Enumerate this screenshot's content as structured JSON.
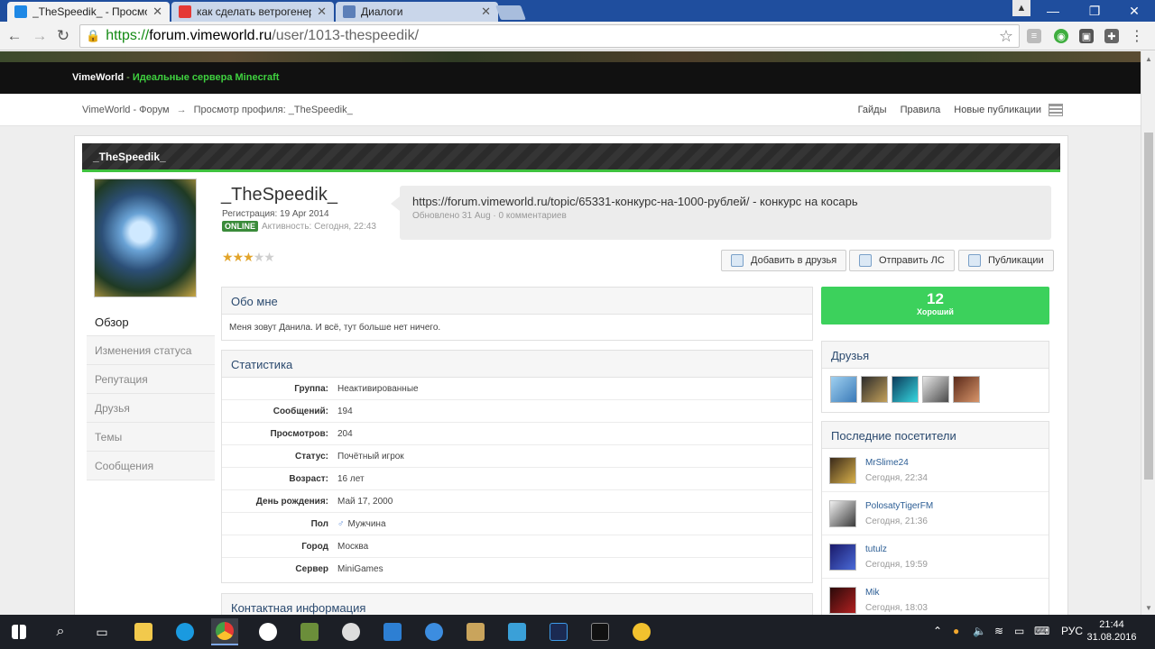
{
  "browser": {
    "tabs": [
      {
        "title": "_TheSpeedik_ - Просмотр",
        "favicon": "vimeworld-icon",
        "color": "#1e88e5"
      },
      {
        "title": "как сделать ветрогенерато",
        "favicon": "youtube-icon",
        "color": "#e53935"
      },
      {
        "title": "Диалоги",
        "favicon": "chat-icon",
        "color": "#5c7fb8"
      }
    ],
    "url": {
      "scheme": "https://",
      "host": "forum.vimeworld.ru",
      "path": "/user/1013-thespeedik/"
    }
  },
  "site": {
    "brand": "VimeWorld",
    "separator": " - ",
    "tagline": "Идеальные сервера Minecraft",
    "breadcrumb": {
      "home": "VimeWorld - Форум",
      "arrow": "→",
      "current": "Просмотр профиля: _TheSpeedik_"
    },
    "toplinks": [
      "Гайды",
      "Правила",
      "Новые публикации"
    ]
  },
  "profile": {
    "header_name": "_TheSpeedik_",
    "username": "_TheSpeedik_",
    "registration": "Регистрация: 19 Apr 2014",
    "online_badge": "ONLINE",
    "activity": "Активность: Сегодня, 22:43",
    "rating_stars": 3,
    "rating_max": 5,
    "status_text": "https://forum.vimeworld.ru/topic/65331-конкурс-на-1000-рублей/ - конкурс на косарь",
    "status_meta": "Обновлено 31 Aug · 0 комментариев",
    "buttons": {
      "add_friend": "Добавить в друзья",
      "send_pm": "Отправить ЛС",
      "posts": "Публикации"
    },
    "menu": [
      "Обзор",
      "Изменения статуса",
      "Репутация",
      "Друзья",
      "Темы",
      "Сообщения"
    ],
    "about": {
      "title": "Обо мне",
      "text": "Меня зовут Данила. И всё, тут больше нет ничего."
    },
    "stats": {
      "title": "Статистика",
      "rows": [
        {
          "k": "Группа:",
          "v": "Неактивированные"
        },
        {
          "k": "Сообщений:",
          "v": "194"
        },
        {
          "k": "Просмотров:",
          "v": "204"
        },
        {
          "k": "Статус:",
          "v": "Почётный игрок"
        },
        {
          "k": "Возраст:",
          "v": "16 лет"
        },
        {
          "k": "День рождения:",
          "v": "Май 17, 2000"
        },
        {
          "k": "Пол",
          "v": "Мужчина"
        },
        {
          "k": "Город",
          "v": "Москва"
        },
        {
          "k": "Сервер",
          "v": "MiniGames"
        }
      ]
    },
    "contact_title": "Контактная информация",
    "reputation": {
      "value": "12",
      "label": "Хороший"
    },
    "friends_title": "Друзья",
    "visitors": {
      "title": "Последние посетители",
      "items": [
        {
          "name": "MrSlime24",
          "time": "Сегодня, 22:34"
        },
        {
          "name": "PolosatyTigerFM",
          "time": "Сегодня, 21:36"
        },
        {
          "name": "tutulz",
          "time": "Сегодня, 19:59"
        },
        {
          "name": "Mik",
          "time": "Сегодня, 18:03"
        }
      ]
    }
  },
  "taskbar": {
    "lang": "РУС",
    "time": "21:44",
    "date": "31.08.2016"
  }
}
